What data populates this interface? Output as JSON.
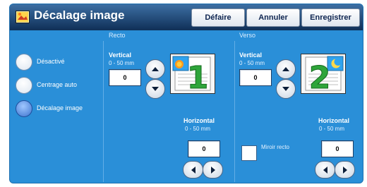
{
  "title": "Décalage image",
  "toolbar": {
    "undo": "Défaire",
    "cancel": "Annuler",
    "save": "Enregistrer"
  },
  "columns": {
    "front": "Recto",
    "back": "Verso"
  },
  "options": [
    {
      "label": "Désactivé",
      "selected": false
    },
    {
      "label": "Centrage auto",
      "selected": false
    },
    {
      "label": "Décalage image",
      "selected": true
    }
  ],
  "front": {
    "vertical_label": "Vertical",
    "vertical_range": "0 - 50 mm",
    "vertical_value": "0",
    "horizontal_label": "Horizontal",
    "horizontal_range": "0 - 50 mm",
    "horizontal_value": "0",
    "page_number": "1"
  },
  "back": {
    "vertical_label": "Vertical",
    "vertical_range": "0 - 50 mm",
    "vertical_value": "0",
    "horizontal_label": "Horizontal",
    "horizontal_range": "0 - 50 mm",
    "horizontal_value": "0",
    "mirror_label": "Miroir recto",
    "page_number": "2"
  },
  "colors": {
    "panel": "#2a8fd8",
    "titlebar": "#0f2f57",
    "page_green": "#2ea53a"
  },
  "icons": [
    "image-shift-icon",
    "up-arrow-icon",
    "down-arrow-icon",
    "left-arrow-icon",
    "right-arrow-icon",
    "sun-icon",
    "moon-icon"
  ]
}
